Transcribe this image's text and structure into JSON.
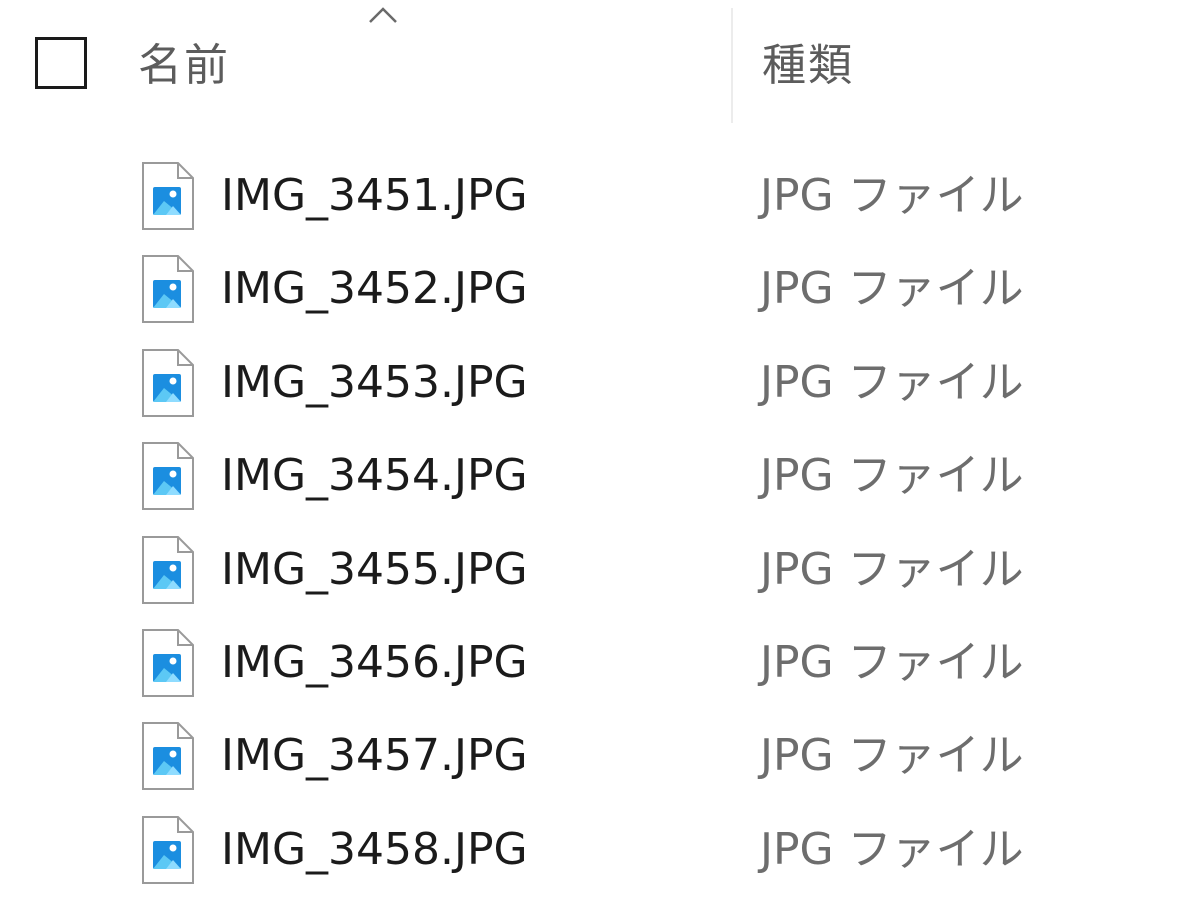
{
  "header": {
    "select_all_checked": false,
    "name_label": "名前",
    "type_label": "種類",
    "sort_icon": "chevron-up-icon"
  },
  "files": [
    {
      "name": "IMG_3451.JPG",
      "type": "JPG ファイル",
      "icon": "image-file-icon"
    },
    {
      "name": "IMG_3452.JPG",
      "type": "JPG ファイル",
      "icon": "image-file-icon"
    },
    {
      "name": "IMG_3453.JPG",
      "type": "JPG ファイル",
      "icon": "image-file-icon"
    },
    {
      "name": "IMG_3454.JPG",
      "type": "JPG ファイル",
      "icon": "image-file-icon"
    },
    {
      "name": "IMG_3455.JPG",
      "type": "JPG ファイル",
      "icon": "image-file-icon"
    },
    {
      "name": "IMG_3456.JPG",
      "type": "JPG ファイル",
      "icon": "image-file-icon"
    },
    {
      "name": "IMG_3457.JPG",
      "type": "JPG ファイル",
      "icon": "image-file-icon"
    },
    {
      "name": "IMG_3458.JPG",
      "type": "JPG ファイル",
      "icon": "image-file-icon"
    }
  ],
  "colors": {
    "icon_page_bg": "#ffffff",
    "icon_page_border": "#9a9a9a",
    "icon_image_bg": "#1b8ee0",
    "icon_mountain": "#5cc8f5",
    "icon_sun": "#ffffff"
  }
}
